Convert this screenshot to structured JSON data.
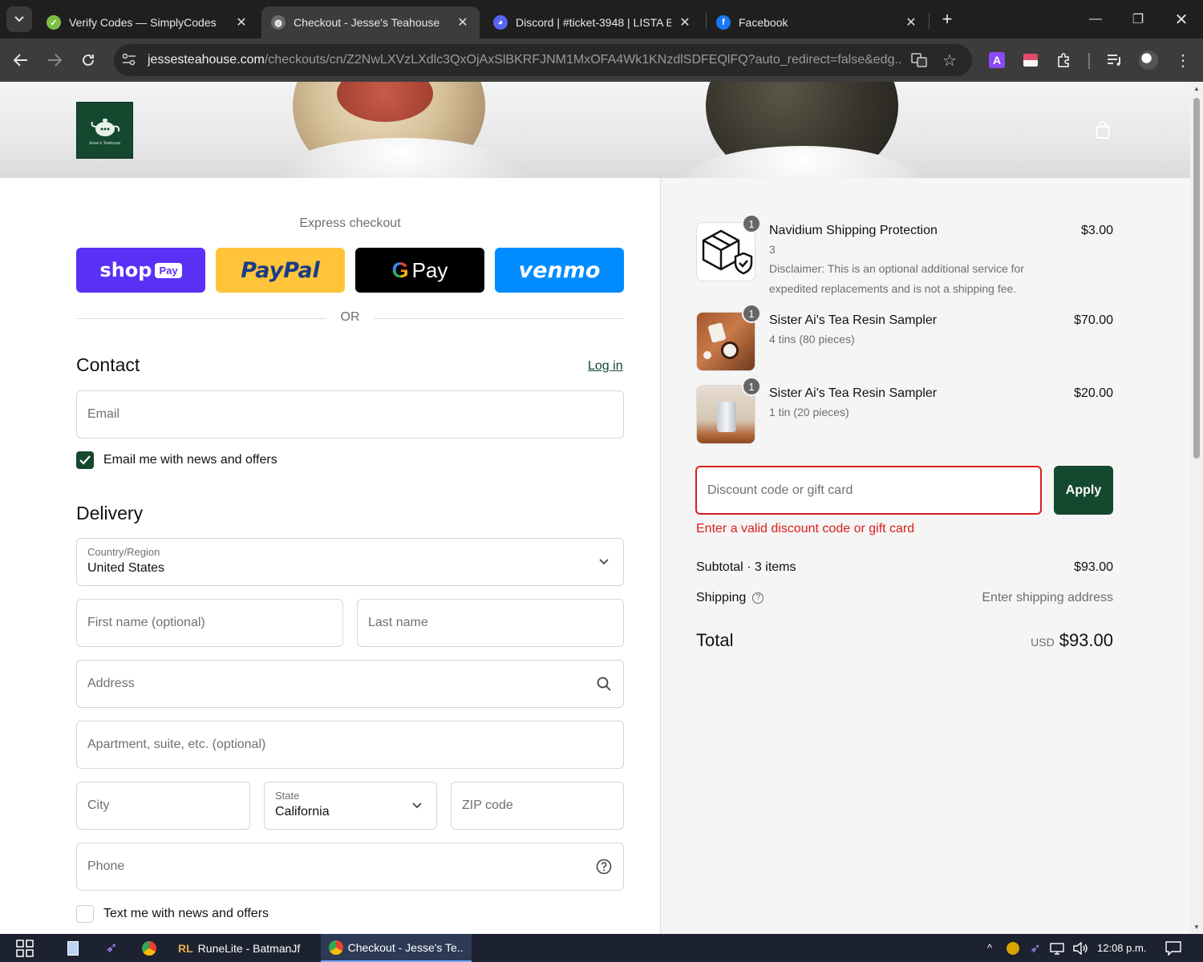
{
  "browser": {
    "tabs": [
      {
        "label": "Verify Codes — SimplyCodes",
        "icon": "simplycodes-icon"
      },
      {
        "label": "Checkout - Jesse's Teahouse",
        "icon": "globe-icon",
        "active": true
      },
      {
        "label": "Discord | #ticket-3948 | LISTA B",
        "icon": "discord-icon"
      },
      {
        "label": "Facebook",
        "icon": "facebook-icon"
      }
    ],
    "url_host": "jessesteahouse.com",
    "url_path": "/checkouts/cn/Z2NwLXVzLXdlc3QxOjAxSlBKRFJNM1MxOFA4Wk1KNzdlSDFEQlFQ?auto_redirect=false&edg..."
  },
  "store": {
    "logo_text": "Jesse's Teahouse"
  },
  "express": {
    "title": "Express checkout",
    "shoppay_label": "shop",
    "shoppay_badge": "Pay",
    "paypal_label": "PayPal",
    "gpay_label": "Pay",
    "venmo_label": "venmo",
    "or_label": "OR"
  },
  "contact": {
    "title": "Contact",
    "login_label": "Log in",
    "email_placeholder": "Email",
    "newsletter_label": "Email me with news and offers",
    "newsletter_checked": true
  },
  "delivery": {
    "title": "Delivery",
    "country_label": "Country/Region",
    "country_value": "United States",
    "first_name_placeholder": "First name (optional)",
    "last_name_placeholder": "Last name",
    "address_placeholder": "Address",
    "apartment_placeholder": "Apartment, suite, etc. (optional)",
    "city_placeholder": "City",
    "state_label": "State",
    "state_value": "California",
    "zip_placeholder": "ZIP code",
    "phone_placeholder": "Phone",
    "sms_label": "Text me with news and offers",
    "sms_checked": false
  },
  "order": {
    "items": [
      {
        "qty": "1",
        "name": "Navidium Shipping Protection",
        "variant": "3",
        "description": "Disclaimer: This is an optional additional service for expedited replacements and is not a shipping fee.",
        "price": "$3.00"
      },
      {
        "qty": "1",
        "name": "Sister Ai's Tea Resin Sampler",
        "variant": "4 tins (80 pieces)",
        "price": "$70.00"
      },
      {
        "qty": "1",
        "name": "Sister Ai's Tea Resin Sampler",
        "variant": "1 tin (20 pieces)",
        "price": "$20.00"
      }
    ],
    "discount_placeholder": "Discount code or gift card",
    "apply_label": "Apply",
    "discount_error": "Enter a valid discount code or gift card",
    "subtotal_label": "Subtotal · 3 items",
    "subtotal_value": "$93.00",
    "shipping_label": "Shipping",
    "shipping_value": "Enter shipping address",
    "total_label": "Total",
    "total_currency": "USD",
    "total_value": "$93.00"
  },
  "taskbar": {
    "apps": [
      {
        "label": "RuneLite - BatmanJf"
      },
      {
        "label": "Checkout - Jesse's Te...",
        "active": true
      }
    ],
    "clock": "12:08 p.m."
  },
  "colors": {
    "brand_green": "#14482f",
    "error_red": "#dd1d1d",
    "shoppay": "#5a31f4",
    "paypal": "#ffc439",
    "venmo": "#008cff"
  }
}
